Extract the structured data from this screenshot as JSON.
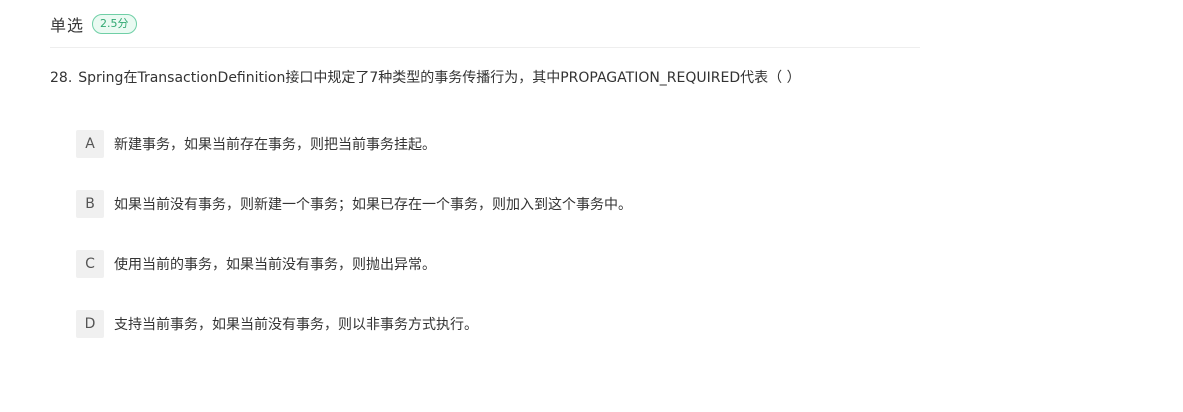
{
  "header": {
    "question_type": "单选",
    "score": "2.5分"
  },
  "question": {
    "number": "28.",
    "text": "Spring在TransactionDefinition接口中规定了7种类型的事务传播行为，其中PROPAGATION_REQUIRED代表（  ）"
  },
  "options": [
    {
      "letter": "A",
      "text": "新建事务，如果当前存在事务，则把当前事务挂起。"
    },
    {
      "letter": "B",
      "text": "如果当前没有事务，则新建一个事务；如果已存在一个事务，则加入到这个事务中。"
    },
    {
      "letter": "C",
      "text": "使用当前的事务，如果当前没有事务，则抛出异常。"
    },
    {
      "letter": "D",
      "text": "支持当前事务，如果当前没有事务，则以非事务方式执行。"
    }
  ],
  "colors": {
    "badge_border": "#6fcfa6",
    "badge_text": "#32a872",
    "option_letter_bg": "#f0f0f0"
  }
}
